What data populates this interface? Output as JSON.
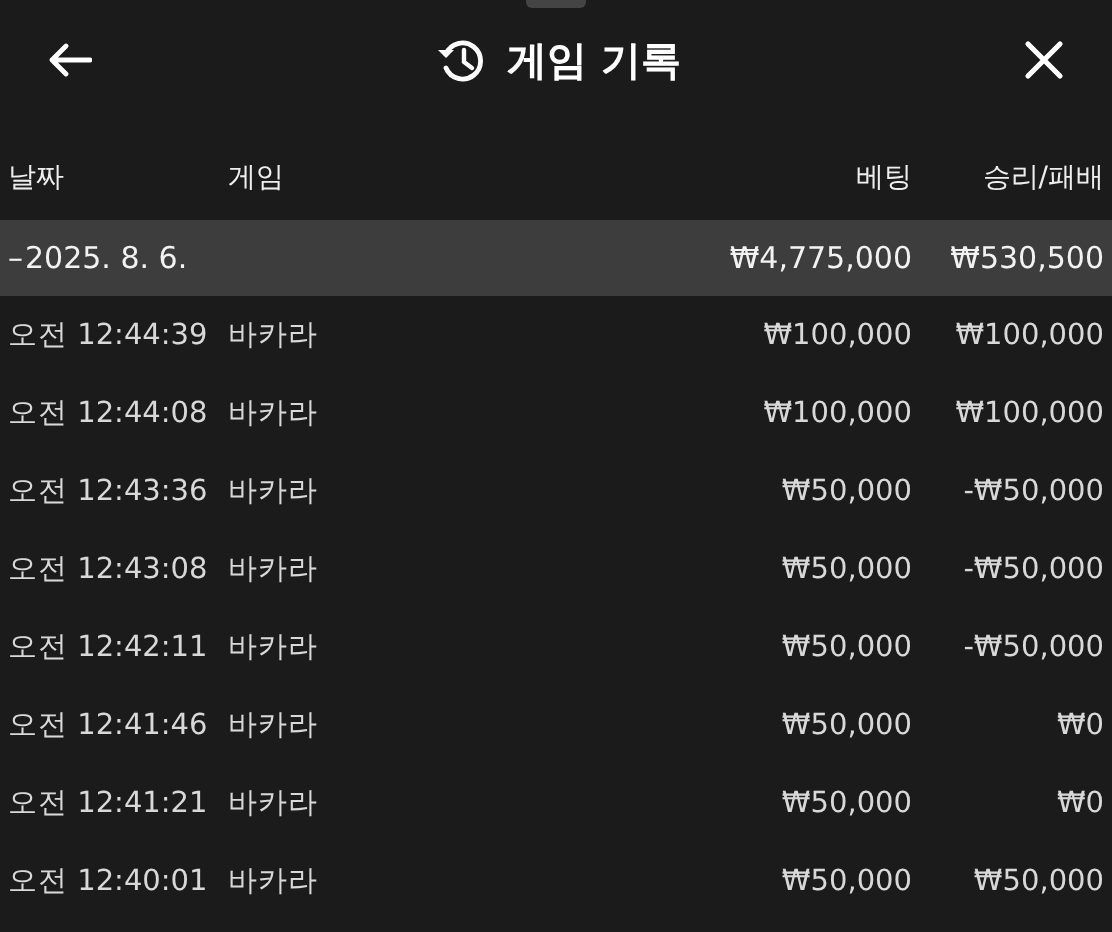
{
  "header": {
    "title": "게임 기록"
  },
  "columns": [
    "날짜",
    "게임",
    "베팅",
    "승리/패배"
  ],
  "groups": [
    {
      "date": "2025. 8. 6.",
      "collapse_mark": "–",
      "total_bet": "₩4,775,000",
      "total_result": "₩530,500",
      "rows": [
        {
          "time": "오전 12:44:39",
          "game": "바카라",
          "bet": "₩100,000",
          "result": "₩100,000"
        },
        {
          "time": "오전 12:44:08",
          "game": "바카라",
          "bet": "₩100,000",
          "result": "₩100,000"
        },
        {
          "time": "오전 12:43:36",
          "game": "바카라",
          "bet": "₩50,000",
          "result": "-₩50,000"
        },
        {
          "time": "오전 12:43:08",
          "game": "바카라",
          "bet": "₩50,000",
          "result": "-₩50,000"
        },
        {
          "time": "오전 12:42:11",
          "game": "바카라",
          "bet": "₩50,000",
          "result": "-₩50,000"
        },
        {
          "time": "오전 12:41:46",
          "game": "바카라",
          "bet": "₩50,000",
          "result": "₩0"
        },
        {
          "time": "오전 12:41:21",
          "game": "바카라",
          "bet": "₩50,000",
          "result": "₩0"
        },
        {
          "time": "오전 12:40:01",
          "game": "바카라",
          "bet": "₩50,000",
          "result": "₩50,000"
        }
      ]
    }
  ]
}
